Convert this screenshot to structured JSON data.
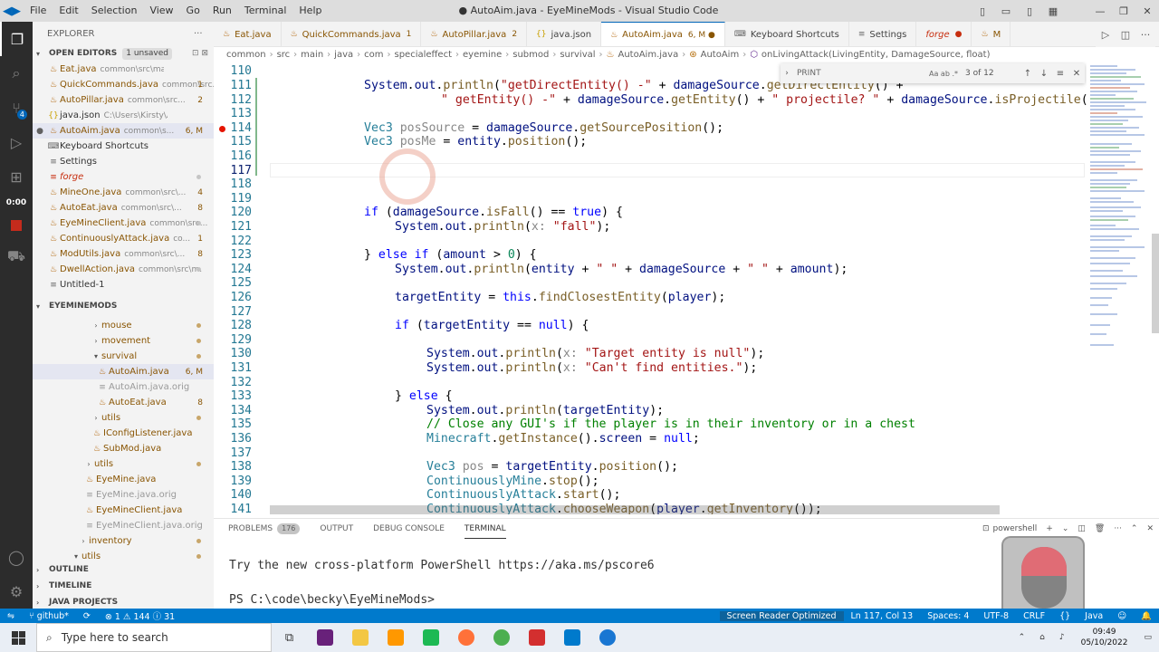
{
  "window": {
    "title": "● AutoAim.java - EyeMineMods - Visual Studio Code",
    "menu": [
      "File",
      "Edit",
      "Selection",
      "View",
      "Go",
      "Run",
      "Terminal",
      "Help"
    ]
  },
  "activity": {
    "scm_badge": "4",
    "timer": "0:00"
  },
  "sidebar": {
    "title": "EXPLORER",
    "open_editors": {
      "label": "OPEN EDITORS",
      "pill": "1 unsaved",
      "items": [
        {
          "name": "Eat.java",
          "path": "common\\src\\main\\java\\c...",
          "count": ""
        },
        {
          "name": "QuickCommands.java",
          "path": "common\\src...",
          "count": "1"
        },
        {
          "name": "AutoPillar.java",
          "path": "common\\src...",
          "count": "2"
        },
        {
          "name": "java.json",
          "path": "C:\\Users\\Kirsty\\AppData...",
          "count": ""
        },
        {
          "name": "AutoAim.java",
          "path": "common\\s...",
          "count": "6, M"
        },
        {
          "name": "Keyboard Shortcuts",
          "path": "",
          "count": ""
        },
        {
          "name": "Settings",
          "path": "",
          "count": ""
        },
        {
          "name": "forge",
          "path": "",
          "count": ""
        },
        {
          "name": "MineOne.java",
          "path": "common\\src\\...",
          "count": "4"
        },
        {
          "name": "AutoEat.java",
          "path": "common\\src\\...",
          "count": "8"
        },
        {
          "name": "EyeMineClient.java",
          "path": "common\\src...",
          "count": ""
        },
        {
          "name": "ContinuouslyAttack.java",
          "path": "co...",
          "count": "1"
        },
        {
          "name": "ModUtils.java",
          "path": "common\\src\\...",
          "count": "8"
        },
        {
          "name": "DwellAction.java",
          "path": "common\\src\\m...",
          "count": ""
        },
        {
          "name": "Untitled-1",
          "path": "",
          "count": ""
        }
      ]
    },
    "project": {
      "label": "EYEMINEMODS",
      "items": [
        {
          "name": "mouse",
          "count": ""
        },
        {
          "name": "movement",
          "count": ""
        },
        {
          "name": "survival",
          "count": ""
        },
        {
          "name": "AutoAim.java",
          "count": "6, M"
        },
        {
          "name": "AutoAim.java.orig",
          "count": ""
        },
        {
          "name": "AutoEat.java",
          "count": "8"
        },
        {
          "name": "utils",
          "count": ""
        },
        {
          "name": "IConfigListener.java",
          "count": ""
        },
        {
          "name": "SubMod.java",
          "count": ""
        },
        {
          "name": "utils",
          "count": ""
        },
        {
          "name": "EyeMine.java",
          "count": ""
        },
        {
          "name": "EyeMine.java.orig",
          "count": ""
        },
        {
          "name": "EyeMineClient.java",
          "count": ""
        },
        {
          "name": "EyeMineClient.java.orig",
          "count": ""
        },
        {
          "name": "inventory",
          "count": ""
        },
        {
          "name": "utils",
          "count": ""
        }
      ]
    },
    "bottom_sections": [
      "OUTLINE",
      "TIMELINE",
      "JAVA PROJECTS"
    ]
  },
  "tabs": [
    {
      "name": "Eat.java",
      "mark": ""
    },
    {
      "name": "QuickCommands.java",
      "mark": "1"
    },
    {
      "name": "AutoPillar.java",
      "mark": "2"
    },
    {
      "name": "java.json",
      "mark": ""
    },
    {
      "name": "AutoAim.java",
      "mark": "6, M ●"
    },
    {
      "name": "Keyboard Shortcuts",
      "mark": ""
    },
    {
      "name": "Settings",
      "mark": ""
    },
    {
      "name": "forge",
      "mark": "●"
    },
    {
      "name": "M",
      "mark": ""
    }
  ],
  "breadcrumbs": [
    "common",
    "src",
    "main",
    "java",
    "com",
    "specialeffect",
    "eyemine",
    "submod",
    "survival",
    "AutoAim.java",
    "AutoAim",
    "onLivingAttack(LivingEntity, DamageSource, float)"
  ],
  "find": {
    "query": "PRINT",
    "flags": "Aa ab .*",
    "result": "3 of 12"
  },
  "editor": {
    "line_numbers": [
      "110",
      "111",
      "112",
      "113",
      "114",
      "115",
      "116",
      "117",
      "118",
      "119",
      "120",
      "121",
      "122",
      "123",
      "124",
      "125",
      "126",
      "127",
      "128",
      "129",
      "130",
      "131",
      "132",
      "133",
      "134",
      "135",
      "136",
      "137",
      "138",
      "139",
      "140",
      "141"
    ],
    "current_line": "117"
  },
  "panel": {
    "tabs": [
      {
        "label": "PROBLEMS",
        "count": "176"
      },
      {
        "label": "OUTPUT",
        "count": ""
      },
      {
        "label": "DEBUG CONSOLE",
        "count": ""
      },
      {
        "label": "TERMINAL",
        "count": ""
      }
    ],
    "shell": "powershell",
    "terminal_lines": [
      "Try the new cross-platform PowerShell https://aka.ms/pscore6",
      "PS C:\\code\\becky\\EyeMineMods>"
    ]
  },
  "status": {
    "branch": "github*",
    "problems": "⊗ 1 ⚠ 144 ⓘ 31",
    "reader": "Screen Reader Optimized",
    "position": "Ln 117, Col 13",
    "spaces": "Spaces: 4",
    "encoding": "UTF-8",
    "eol": "CRLF",
    "language": "Java"
  },
  "taskbar": {
    "search_placeholder": "Type here to search",
    "time": "09:49",
    "date": "05/10/2022"
  }
}
